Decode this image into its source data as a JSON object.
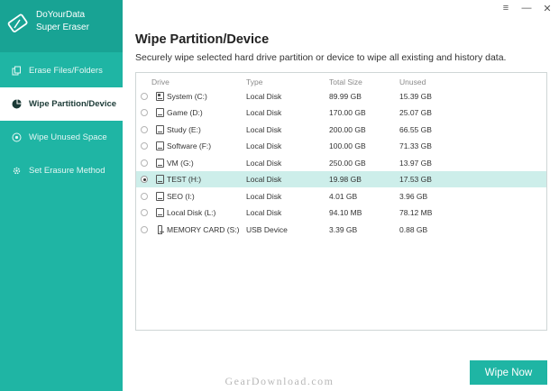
{
  "app": {
    "name_line1": "DoYourData",
    "name_line2": "Super Eraser"
  },
  "window_controls": {
    "menu": "≡",
    "minimize": "—",
    "close": "✕"
  },
  "sidebar": {
    "items": [
      {
        "label": "Erase Files/Folders",
        "icon": "files-icon",
        "active": false
      },
      {
        "label": "Wipe Partition/Device",
        "icon": "pie-icon",
        "active": true
      },
      {
        "label": "Wipe Unused Space",
        "icon": "disk-icon",
        "active": false
      },
      {
        "label": "Set Erasure Method",
        "icon": "gear-icon",
        "active": false
      }
    ]
  },
  "main": {
    "title": "Wipe Partition/Device",
    "subtitle": "Securely wipe selected hard drive partition or device to wipe all existing and history data."
  },
  "table": {
    "columns": {
      "drive": "Drive",
      "type": "Type",
      "total": "Total Size",
      "unused": "Unused"
    },
    "rows": [
      {
        "drive": "System (C:)",
        "type": "Local Disk",
        "total": "89.99 GB",
        "unused": "15.39 GB",
        "icon": "system-drive-icon",
        "selected": false
      },
      {
        "drive": "Game (D:)",
        "type": "Local Disk",
        "total": "170.00 GB",
        "unused": "25.07 GB",
        "icon": "drive-icon",
        "selected": false
      },
      {
        "drive": "Study (E:)",
        "type": "Local Disk",
        "total": "200.00 GB",
        "unused": "66.55 GB",
        "icon": "drive-icon",
        "selected": false
      },
      {
        "drive": "Software (F:)",
        "type": "Local Disk",
        "total": "100.00 GB",
        "unused": "71.33 GB",
        "icon": "drive-icon",
        "selected": false
      },
      {
        "drive": "VM (G:)",
        "type": "Local Disk",
        "total": "250.00 GB",
        "unused": "13.97 GB",
        "icon": "drive-icon",
        "selected": false
      },
      {
        "drive": "TEST (H:)",
        "type": "Local Disk",
        "total": "19.98 GB",
        "unused": "17.53 GB",
        "icon": "drive-icon",
        "selected": true
      },
      {
        "drive": "SEO (I:)",
        "type": "Local Disk",
        "total": "4.01 GB",
        "unused": "3.96 GB",
        "icon": "drive-icon",
        "selected": false
      },
      {
        "drive": "Local Disk (L:)",
        "type": "Local Disk",
        "total": "94.10 MB",
        "unused": "78.12 MB",
        "icon": "drive-icon",
        "selected": false
      },
      {
        "drive": "MEMORY CARD (S:)",
        "type": "USB Device",
        "total": "3.39 GB",
        "unused": "0.88 GB",
        "icon": "usb-drive-icon",
        "selected": false
      }
    ]
  },
  "actions": {
    "wipe_label": "Wipe Now"
  },
  "watermark": "GearDownload.com",
  "colors": {
    "accent": "#1fb5a4",
    "brand_bar": "#18a394",
    "selected_row": "#cdeeea"
  }
}
